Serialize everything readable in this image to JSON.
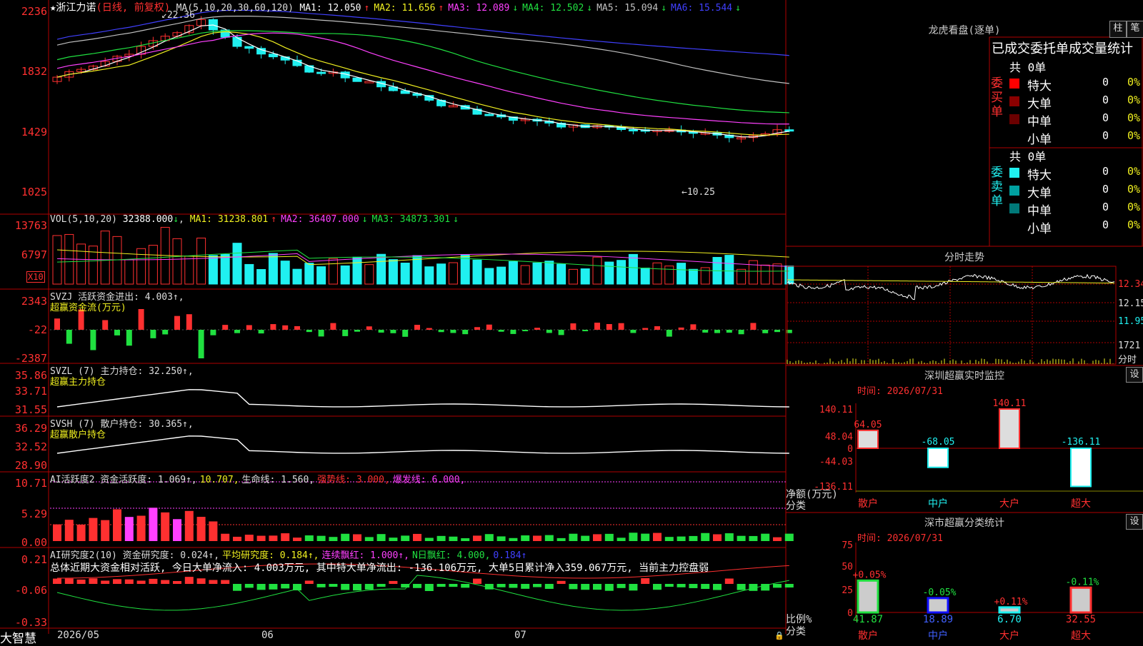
{
  "window": {
    "brand": "大智慧",
    "stock_name": "★浙江力诺",
    "mode": "(日线, 前复权)"
  },
  "colors": {
    "up": "#ff3030",
    "down": "#20f0f0",
    "ma1": "#ffffff",
    "ma2": "#f0f020",
    "ma3": "#ff40ff",
    "ma4": "#20e040",
    "ma5": "#c0c0c0",
    "ma6": "#4040ff",
    "axis": "#b00000"
  },
  "kline": {
    "ma_label": "MA(5,10,20,30,60,120)",
    "ma_values": [
      {
        "label": "MA1: 12.050",
        "arrow": "↑",
        "color": "#ffffff"
      },
      {
        "label": "MA2: 11.656",
        "arrow": "↑",
        "color": "#f0f020"
      },
      {
        "label": "MA3: 12.089",
        "arrow": "↓",
        "color": "#ff40ff"
      },
      {
        "label": "MA4: 12.502",
        "arrow": "↓",
        "color": "#20e040"
      },
      {
        "label": "MA5: 15.094",
        "arrow": "↓",
        "color": "#c0c0c0"
      },
      {
        "label": "MA6: 15.544",
        "arrow": "↓",
        "color": "#4040ff"
      }
    ],
    "y_ticks": [
      "2236",
      "1832",
      "1429",
      "1025"
    ],
    "high_label": "22.36",
    "low_label": "10.25"
  },
  "vol": {
    "label": "VOL(5,10,20)",
    "value": "32388.000",
    "arrow": "↓",
    "mas": [
      {
        "label": "MA1: 31238.801",
        "arrow": "↑",
        "color": "#f0f020"
      },
      {
        "label": "MA2: 36407.000",
        "arrow": "↓",
        "color": "#ff40ff"
      },
      {
        "label": "MA3: 34873.301",
        "arrow": "↓",
        "color": "#20e040"
      }
    ],
    "y_ticks": [
      "13763",
      "6797"
    ],
    "unit": "X10"
  },
  "svzj": {
    "title": "SVZJ  活跃资金进出: 4.003↑,",
    "subtitle": "超赢资金流(万元)",
    "y_ticks": [
      "2343",
      "-22",
      "-2387"
    ]
  },
  "svzl": {
    "title": "SVZL (7) 主力持仓: 32.250↑,",
    "subtitle": "超赢主力持仓",
    "y_ticks": [
      "35.86",
      "33.71",
      "31.55"
    ]
  },
  "svsh": {
    "title": "SVSH (7) 散户持仓: 30.365↑,",
    "subtitle": "超赢散户持仓",
    "y_ticks": [
      "36.29",
      "32.52",
      "28.90"
    ]
  },
  "ai_active": {
    "title_parts": [
      {
        "text": "AI活跃度2 资金活跃度: 1.069↑,",
        "color": "#ddd"
      },
      {
        "text": "10.707,",
        "color": "#f0f020"
      },
      {
        "text": "生命线: 1.560,",
        "color": "#ddd"
      },
      {
        "text": "强势线: 3.000,",
        "color": "#ff3030"
      },
      {
        "text": "爆发线: 6.000,",
        "color": "#ff40ff"
      }
    ],
    "y_ticks": [
      "10.71",
      "5.29",
      "0.00"
    ]
  },
  "ai_research": {
    "title_parts": [
      {
        "text": "AI研究度2(10) 资金研究度: 0.024↑,",
        "color": "#ddd"
      },
      {
        "text": "平均研究度: 0.184↑,",
        "color": "#f0f020"
      },
      {
        "text": "连续飘红: 1.000↑,",
        "color": "#ff40ff"
      },
      {
        "text": "N日飘红: 4.000,",
        "color": "#20e040"
      },
      {
        "text": "0.184↑",
        "color": "#4040ff"
      }
    ],
    "summary": "总体近期大资金相对活跃, 今日大单净流入: 4.003万元, 其中特大单净流出: -136.106万元, 大单5日累计净入359.067万元, 当前主力控盘弱",
    "y_ticks": [
      "0.21",
      "-0.06",
      "-0.33"
    ]
  },
  "x_axis": {
    "labels": [
      "2026/05",
      "06",
      "07"
    ]
  },
  "dragon": {
    "title": "龙虎看盘(逐单)",
    "btn1": "柱",
    "btn2": "笔",
    "stat_title": "已成交委托单成交量统计",
    "buy_side": "委买单",
    "sell_side": "委卖单",
    "buy_total": "共 0单",
    "sell_total": "共 0单",
    "buy_rows": [
      {
        "name": "特大",
        "count": "0",
        "pct": "0%",
        "color": "#ff0000"
      },
      {
        "name": "大单",
        "count": "0",
        "pct": "0%",
        "color": "#8b0000"
      },
      {
        "name": "中单",
        "count": "0",
        "pct": "0%",
        "color": "#6b0000"
      },
      {
        "name": "小单",
        "count": "0",
        "pct": "0%",
        "color": "#000000"
      }
    ],
    "sell_rows": [
      {
        "name": "特大",
        "count": "0",
        "pct": "0%",
        "color": "#20f0f0"
      },
      {
        "name": "大单",
        "count": "0",
        "pct": "0%",
        "color": "#00a0a0"
      },
      {
        "name": "中单",
        "count": "0",
        "pct": "0%",
        "color": "#007878"
      },
      {
        "name": "小单",
        "count": "0",
        "pct": "0%",
        "color": "#000000"
      }
    ]
  },
  "intraday": {
    "title": "分时走势",
    "prices": [
      "12.34",
      "12.15",
      "11.95"
    ],
    "vol": "1721",
    "vol_unit": "分时"
  },
  "sz_monitor": {
    "title": "深圳超赢实时监控",
    "set": "设",
    "time": "时间: 2026/07/31",
    "y_ticks": [
      "140.11",
      "48.04",
      "0",
      "-44.03",
      "-136.11"
    ],
    "ylabel": "净额(万元)",
    "xlabel": "分类",
    "categories": [
      "散户",
      "中户",
      "大户",
      "超大"
    ],
    "values": [
      64.05,
      -68.05,
      140.11,
      -136.11
    ],
    "value_labels": [
      "64.05",
      "-68.05",
      "140.11",
      "-136.11"
    ]
  },
  "sz_class": {
    "title": "深市超赢分类统计",
    "set": "设",
    "time": "时间: 2026/07/31",
    "y_ticks": [
      "75",
      "50",
      "25",
      "0"
    ],
    "ylabel": "比例%",
    "xlabel": "分类",
    "categories": [
      "散户",
      "中户",
      "大户",
      "超大"
    ],
    "values": [
      41.87,
      18.89,
      6.7,
      32.55
    ],
    "value_labels": [
      "41.87",
      "18.89",
      "6.70",
      "32.55"
    ],
    "change_labels": [
      "+0.05%",
      "-0.05%",
      "+0.11%",
      "-0.11%"
    ]
  }
}
